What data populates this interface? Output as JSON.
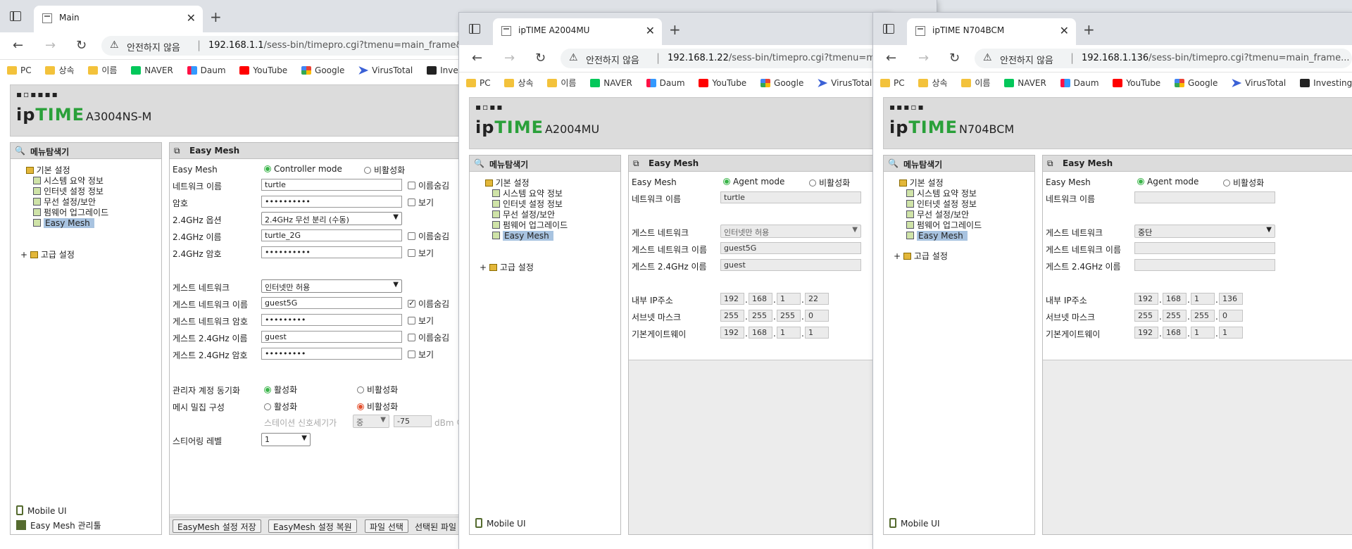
{
  "bookmarks": [
    "PC",
    "상속",
    "이름",
    "NAVER",
    "Daum",
    "YouTube",
    "Google",
    "VirusTotal",
    "Inves"
  ],
  "bookmarks2": [
    "PC",
    "상속",
    "이름",
    "NAVER",
    "Daum",
    "YouTube",
    "Google",
    "VirusTotal"
  ],
  "bookmarks3": [
    "PC",
    "상속",
    "이름",
    "NAVER",
    "Daum",
    "YouTube",
    "Google",
    "VirusTotal",
    "Investing"
  ],
  "security_label": "안전하지 않음",
  "menu_title": "메뉴탐색기",
  "tree": {
    "basic": "기본 설정",
    "items": [
      "시스템 요약 정보",
      "인터넷 설정 정보",
      "무선 설정/보안",
      "펌웨어 업그레이드",
      "Easy Mesh"
    ],
    "advanced": "고급 설정"
  },
  "mobile_ui": "Mobile UI",
  "easymesh_tool": "Easy Mesh 관리툴",
  "panel_title": "Easy Mesh",
  "labels": {
    "easy_mesh": "Easy Mesh",
    "network_name": "네트워크 이름",
    "password": "암호",
    "opt_24": "2.4GHz 옵션",
    "name_24": "2.4GHz 이름",
    "pw_24": "2.4GHz 암호",
    "guest_net": "게스트 네트워크",
    "guest_name": "게스트 네트워크 이름",
    "guest_pw": "게스트 네트워크 암호",
    "guest_24_name": "게스트 2.4GHz 이름",
    "guest_24_pw": "게스트 2.4GHz 암호",
    "admin_sync": "관리자 계정 동기화",
    "mesh_dense": "메시 밀집 구성",
    "station_signal": "스테이션 신호세기가",
    "steering": "스티어링 레벨",
    "internal_ip": "내부 IP주소",
    "subnet": "서브넷 마스크",
    "gateway": "기본게이트웨이",
    "controller_mode": "Controller mode",
    "agent_mode": "Agent mode",
    "disable": "비활성화",
    "enable": "활성화",
    "hide_name": "이름숨김",
    "show": "보기",
    "dbm": "dBm 이"
  },
  "win1": {
    "tab_title": "Main",
    "url_host": "192.168.1.1",
    "url_path": "/sess-bin/timepro.cgi?tmenu=main_frame&s...",
    "dots": "▪▫▪▪▪▪",
    "model": "A3004NS-M",
    "network_name": "turtle",
    "password": "••••••••••",
    "opt_24": "2.4GHz 무선 분리 (수동)",
    "name_24": "turtle_2G",
    "pw_24": "••••••••••",
    "guest_net": "인터넷만 허용",
    "guest_name": "guest5G",
    "guest_pw": "•••••••••",
    "guest_24_name": "guest",
    "guest_24_pw": "•••••••••",
    "signal_level": "중",
    "signal_value": "-75",
    "steering": "1",
    "btn_save": "EasyMesh 설정 저장",
    "btn_restore": "EasyMesh 설정 복원",
    "btn_file": "파일 선택",
    "file_text": "선택된 파일"
  },
  "win2": {
    "tab_title": "ipTIME A2004MU",
    "url_host": "192.168.1.22",
    "url_path": "/sess-bin/timepro.cgi?tmenu=main",
    "dots": "▪▫▪▪",
    "model": "A2004MU",
    "network_name": "turtle",
    "guest_net": "인터넷만 허용",
    "guest_name": "guest5G",
    "guest_24_name": "guest",
    "ip": [
      "192",
      "168",
      "1",
      "22"
    ],
    "mask": [
      "255",
      "255",
      "255",
      "0"
    ],
    "gw": [
      "192",
      "168",
      "1",
      "1"
    ]
  },
  "win3": {
    "tab_title": "ipTIME N704BCM",
    "url_host": "192.168.1.136",
    "url_path": "/sess-bin/timepro.cgi?tmenu=main_frame...",
    "dots": "▪▪▪▫▪",
    "model": "N704BCM",
    "network_name": "",
    "guest_net": "중단",
    "guest_name": "",
    "guest_24_name": "",
    "ip": [
      "192",
      "168",
      "1",
      "136"
    ],
    "mask": [
      "255",
      "255",
      "255",
      "0"
    ],
    "gw": [
      "192",
      "168",
      "1",
      "1"
    ]
  }
}
